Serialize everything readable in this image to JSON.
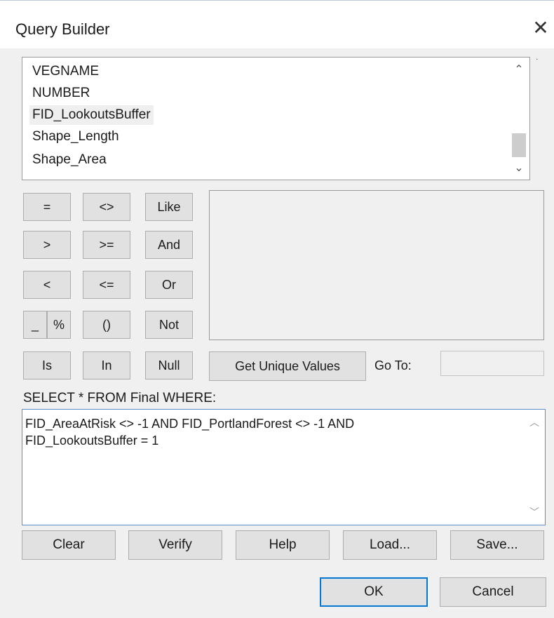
{
  "window": {
    "title": "Query Builder",
    "close_glyph": "✕"
  },
  "fields": {
    "items": [
      "VEGNAME",
      "NUMBER",
      "FID_LookoutsBuffer",
      "Shape_Length",
      "Shape_Area"
    ],
    "selected_index": 2,
    "scroll_up_glyph": "⌃",
    "scroll_down_glyph": "⌄"
  },
  "operators": {
    "eq": "=",
    "ne": "<>",
    "like": "Like",
    "gt": ">",
    "ge": ">=",
    "and": "And",
    "lt": "<",
    "le": "<=",
    "or": "Or",
    "underscore": "_",
    "percent": "%",
    "parens": "()",
    "not": "Not",
    "is": "Is",
    "in": "In",
    "null": "Null"
  },
  "unique": {
    "button": "Get Unique Values",
    "goto_label": "Go To:",
    "goto_value": ""
  },
  "query": {
    "select_label": "SELECT * FROM Final WHERE:",
    "expression": "FID_AreaAtRisk <> -1 AND FID_PortlandForest <> -1 AND\nFID_LookoutsBuffer = 1"
  },
  "actions": {
    "clear": "Clear",
    "verify": "Verify",
    "help": "Help",
    "load": "Load...",
    "save": "Save..."
  },
  "dialog_buttons": {
    "ok": "OK",
    "cancel": "Cancel"
  },
  "colors": {
    "focus_border": "#0078d7",
    "button_face": "#e1e1e1",
    "background": "#f0f0f0"
  }
}
